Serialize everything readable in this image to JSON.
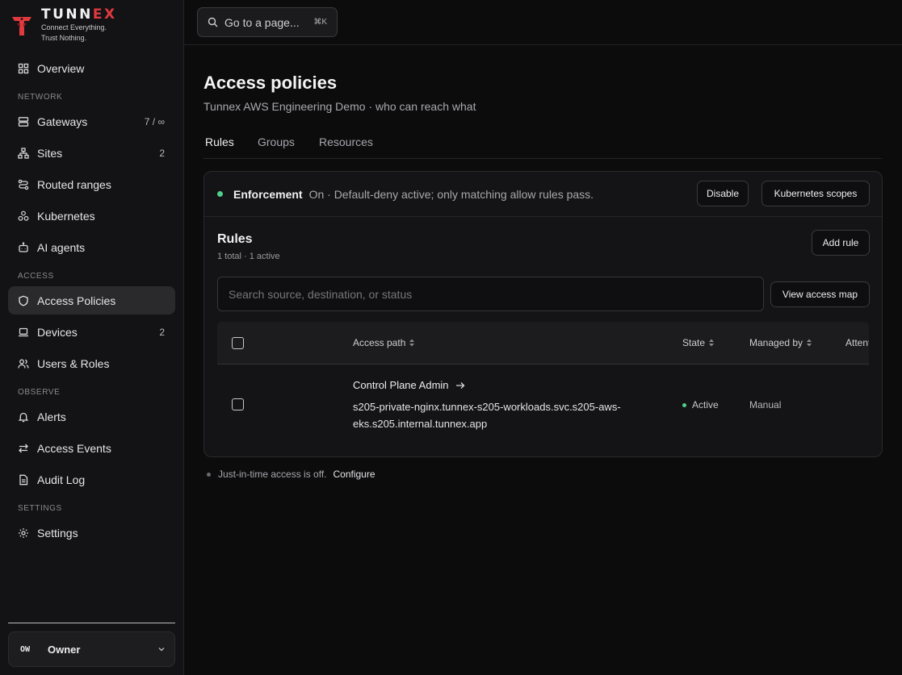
{
  "brand": {
    "name_main": "TUNN",
    "name_accent": "EX",
    "tagline_line1": "Connect Everything.",
    "tagline_line2": "Trust Nothing."
  },
  "sidebar": {
    "sections": {
      "network": "NETWORK",
      "access": "ACCESS",
      "observe": "OBSERVE",
      "settings": "SETTINGS"
    },
    "items": [
      {
        "label": "Overview",
        "icon": "grid-icon",
        "count": ""
      },
      {
        "label": "Gateways",
        "icon": "server-icon",
        "count": "7 / ∞"
      },
      {
        "label": "Sites",
        "icon": "network-icon",
        "count": "2"
      },
      {
        "label": "Routed ranges",
        "icon": "route-icon",
        "count": ""
      },
      {
        "label": "Kubernetes",
        "icon": "cubes-icon",
        "count": ""
      },
      {
        "label": "AI agents",
        "icon": "bot-icon",
        "count": ""
      },
      {
        "label": "Access Policies",
        "icon": "shield-icon",
        "count": "",
        "active": true
      },
      {
        "label": "Devices",
        "icon": "laptop-icon",
        "count": "2"
      },
      {
        "label": "Users & Roles",
        "icon": "users-icon",
        "count": ""
      },
      {
        "label": "Alerts",
        "icon": "bell-icon",
        "count": ""
      },
      {
        "label": "Access Events",
        "icon": "arrows-icon",
        "count": ""
      },
      {
        "label": "Audit Log",
        "icon": "file-icon",
        "count": ""
      },
      {
        "label": "Settings",
        "icon": "gear-icon",
        "count": ""
      }
    ],
    "account": {
      "avatar": "OW",
      "name": "Owner"
    }
  },
  "topbar": {
    "search_label": "Go to a page...",
    "search_shortcut": "⌘K"
  },
  "main": {
    "title": "Access policies",
    "subtitle": "Tunnex AWS Engineering Demo · who can reach what",
    "tabs": [
      {
        "label": "Rules",
        "active": true
      },
      {
        "label": "Groups"
      },
      {
        "label": "Resources"
      }
    ],
    "enforcement": {
      "label": "Enforcement",
      "description": "On · Default-deny active; only matching allow rules pass.",
      "disable_label": "Disable",
      "k8s_label": "Kubernetes scopes"
    },
    "rules": {
      "title": "Rules",
      "summary": "1 total · 1 active",
      "add_label": "Add rule",
      "search_placeholder": "Search source, destination, or status",
      "map_label": "View access map",
      "columns": {
        "access_path": "Access path",
        "state": "State",
        "managed_by": "Managed by",
        "attention": "Attention"
      },
      "rows": [
        {
          "name": "Control Plane Admin",
          "destination": "s205-private-nginx.tunnex-s205-workloads.svc.s205-aws-eks.s205.internal.tunnex.app",
          "state": "Active",
          "managed_by": "Manual"
        }
      ]
    },
    "jit": {
      "text": "Just-in-time access is off.",
      "link": "Configure"
    }
  },
  "colors": {
    "accent_red": "#e0393e",
    "status_green": "#4fd08a",
    "active_nav_bg": "#2a2a2d"
  }
}
